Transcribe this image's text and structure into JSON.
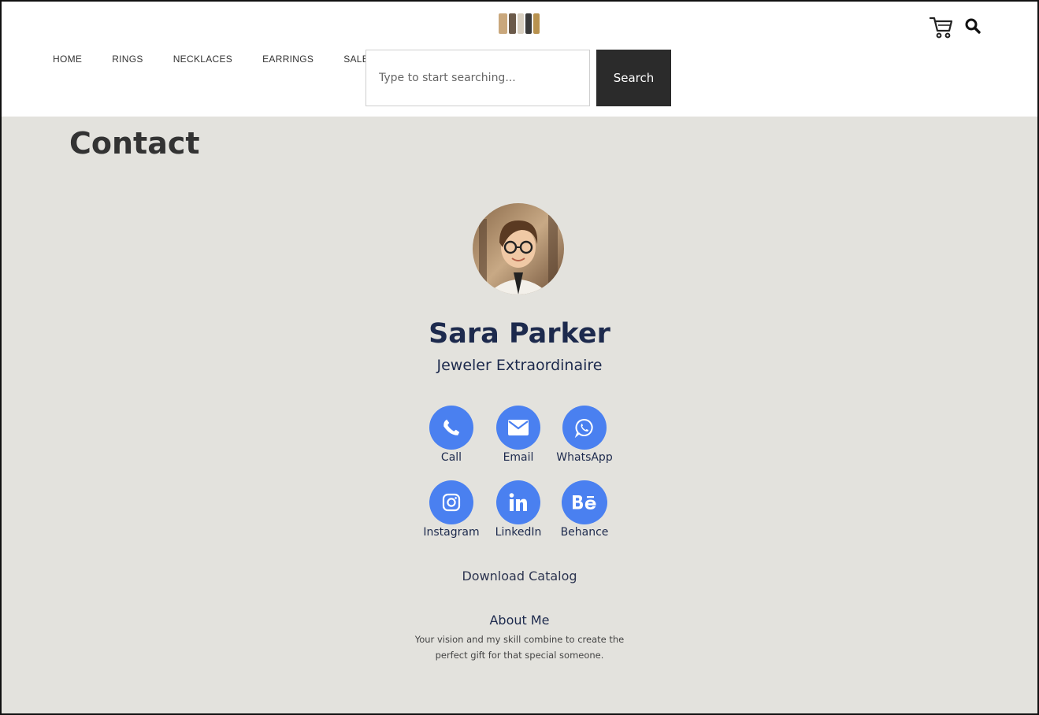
{
  "nav": {
    "items": [
      "HOME",
      "RINGS",
      "NECKLACES",
      "EARRINGS",
      "SALE"
    ]
  },
  "search": {
    "placeholder": "Type to start searching...",
    "value": "",
    "button_label": "Search"
  },
  "page": {
    "title": "Contact"
  },
  "profile": {
    "name": "Sara Parker",
    "role": "Jeweler Extraordinaire"
  },
  "contacts": [
    {
      "label": "Call",
      "icon": "phone-icon"
    },
    {
      "label": "Email",
      "icon": "envelope-icon"
    },
    {
      "label": "WhatsApp",
      "icon": "whatsapp-icon"
    },
    {
      "label": "Instagram",
      "icon": "instagram-icon"
    },
    {
      "label": "LinkedIn",
      "icon": "linkedin-icon"
    },
    {
      "label": "Behance",
      "icon": "behance-icon"
    }
  ],
  "catalog": {
    "label": "Download Catalog"
  },
  "about": {
    "title": "About Me",
    "text": "Your vision and my skill combine to create the perfect gift for that special someone."
  },
  "colors": {
    "accent": "#4a80f0",
    "page_bg": "#e3e2dd",
    "header_bg": "#ffffff",
    "search_button_bg": "#2b2b2b",
    "name_color": "#1d2a4d"
  }
}
